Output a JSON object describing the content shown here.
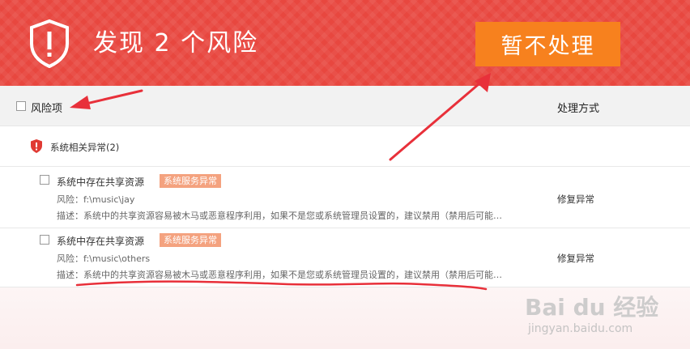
{
  "header": {
    "title": "发现 2 个风险",
    "ignore_label": "暂不处理"
  },
  "columns": {
    "risk": "风险项",
    "action": "处理方式"
  },
  "group": {
    "label": "系统相关异常(2)"
  },
  "items": [
    {
      "title": "系统中存在共享资源",
      "badge": "系统服务异常",
      "risk": "风险：f:\\music\\jay",
      "desc": "描述：系统中的共享资源容易被木马或恶意程序利用，如果不是您或系统管理员设置的，建议禁用（禁用后可能…",
      "action": "修复异常"
    },
    {
      "title": "系统中存在共享资源",
      "badge": "系统服务异常",
      "risk": "风险：f:\\music\\others",
      "desc": "描述：系统中的共享资源容易被木马或恶意程序利用，如果不是您或系统管理员设置的，建议禁用（禁用后可能…",
      "action": "修复异常"
    }
  ],
  "watermark": {
    "main": "Bai du 经验",
    "sub": "jingyan.baidu.com"
  },
  "colors": {
    "header_bg": "#e8473f",
    "button_bg": "#f7811e",
    "badge_bg": "#f4a27f",
    "annotation": "#e8303a"
  }
}
